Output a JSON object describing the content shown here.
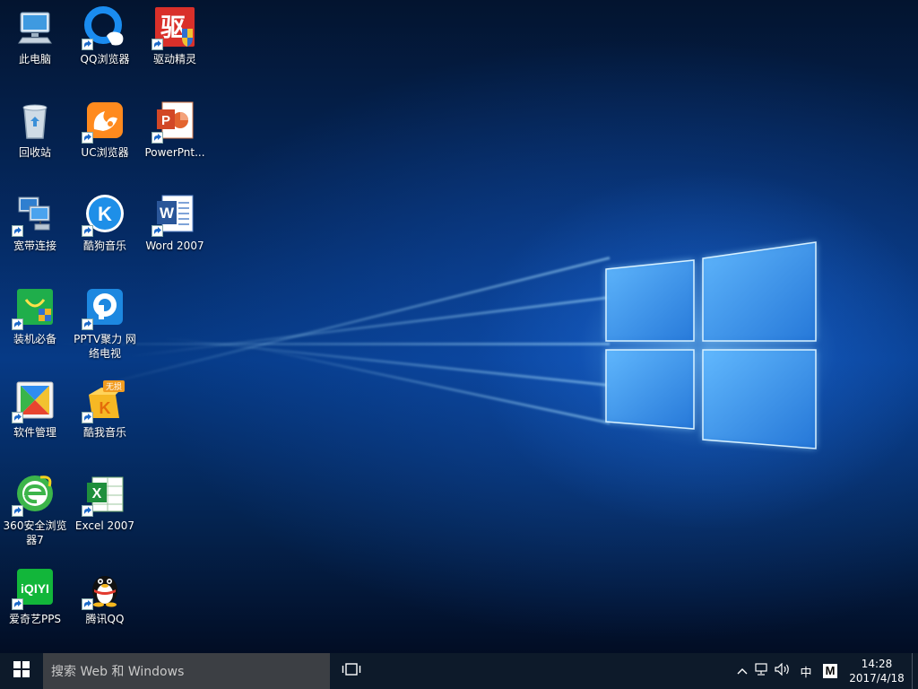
{
  "desktop": {
    "icons": [
      {
        "id": "this-pc",
        "label": "此电脑",
        "icon": "computer-icon",
        "shortcut": false
      },
      {
        "id": "recycle-bin",
        "label": "回收站",
        "icon": "recycle-bin-icon",
        "shortcut": false
      },
      {
        "id": "broadband",
        "label": "宽带连接",
        "icon": "network-icon",
        "shortcut": true
      },
      {
        "id": "essentials",
        "label": "装机必备",
        "icon": "shopping-bag-icon",
        "shortcut": true
      },
      {
        "id": "software-manager",
        "label": "软件管理",
        "icon": "software-manager-icon",
        "shortcut": true
      },
      {
        "id": "browser-360",
        "label": "360安全浏览器7",
        "icon": "browser-360-icon",
        "shortcut": true
      },
      {
        "id": "iqiyi",
        "label": "爱奇艺PPS",
        "icon": "iqiyi-icon",
        "shortcut": true
      },
      {
        "id": "qq-browser",
        "label": "QQ浏览器",
        "icon": "qq-browser-icon",
        "shortcut": true
      },
      {
        "id": "uc-browser",
        "label": "UC浏览器",
        "icon": "uc-browser-icon",
        "shortcut": true
      },
      {
        "id": "kugou",
        "label": "酷狗音乐",
        "icon": "kugou-icon",
        "shortcut": true
      },
      {
        "id": "pptv",
        "label": "PPTV聚力 网络电视",
        "icon": "pptv-icon",
        "shortcut": true
      },
      {
        "id": "kuwo",
        "label": "酷我音乐",
        "icon": "kuwo-icon",
        "shortcut": true
      },
      {
        "id": "excel",
        "label": "Excel 2007",
        "icon": "excel-icon",
        "shortcut": true
      },
      {
        "id": "tencent-qq",
        "label": "腾讯QQ",
        "icon": "qq-penguin-icon",
        "shortcut": true
      },
      {
        "id": "driver-genius",
        "label": "驱动精灵",
        "icon": "driver-genius-icon",
        "shortcut": true
      },
      {
        "id": "powerpoint",
        "label": "PowerPnt...",
        "icon": "powerpoint-icon",
        "shortcut": true
      },
      {
        "id": "word",
        "label": "Word 2007",
        "icon": "word-icon",
        "shortcut": true
      }
    ],
    "badges": {
      "kuwo": "无损",
      "iqiyi": "iQIYI",
      "kugou": "K",
      "driver": "驱",
      "word": "W"
    }
  },
  "taskbar": {
    "search_placeholder": "搜索 Web 和 Windows",
    "ime_label": "中",
    "ime_mode": "M",
    "time": "14:28",
    "date": "2017/4/18",
    "colors": {
      "bar": "#0d1a2a",
      "search": "#3c3f44"
    }
  },
  "wallpaper": {
    "accent": "#1e6fd9",
    "glow": "#9fd8ff"
  }
}
